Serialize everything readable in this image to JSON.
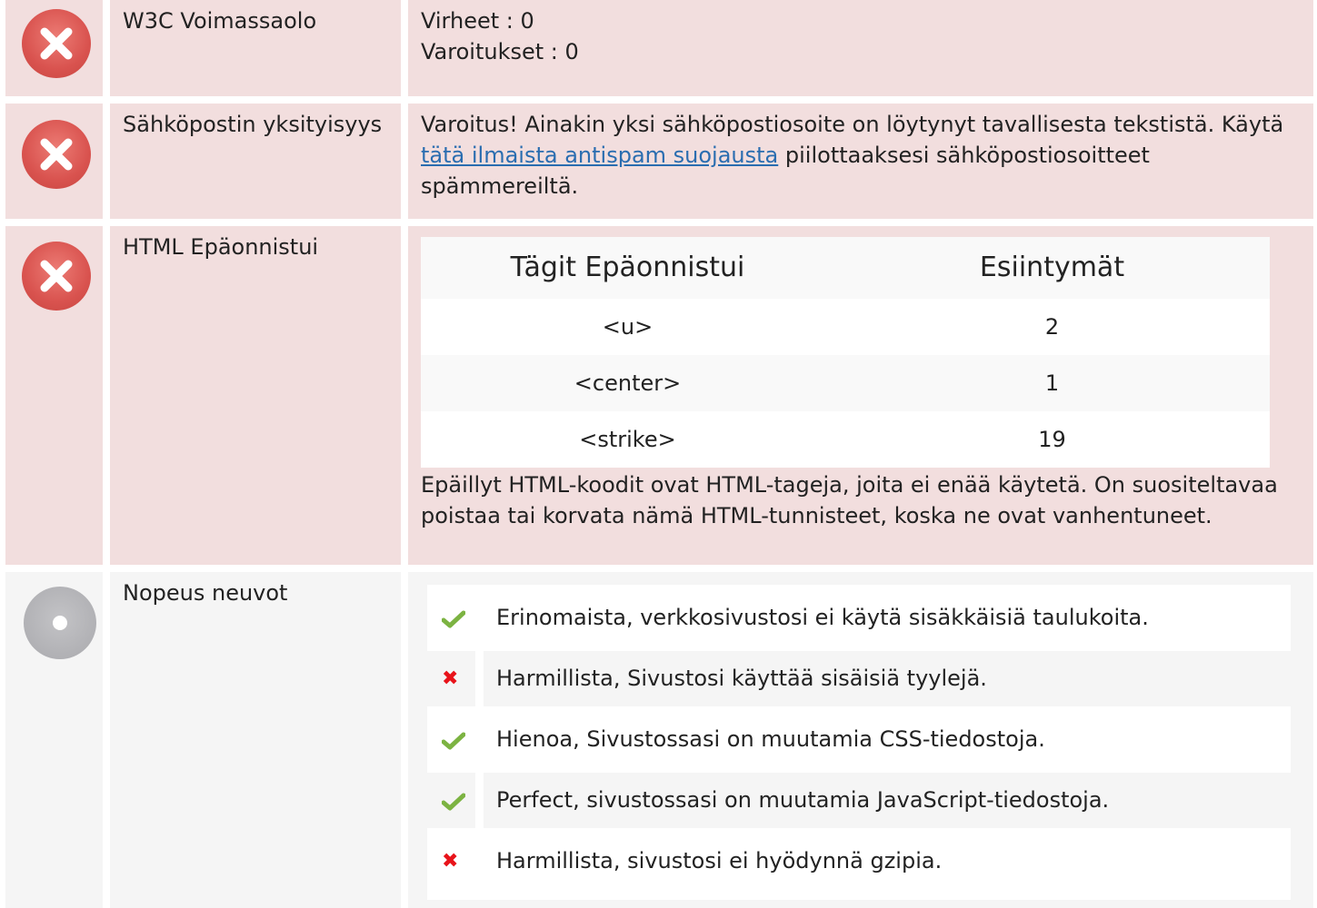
{
  "rows": [
    {
      "label": "W3C Voimassaolo",
      "status": "fail",
      "errors_text": "Virheet : 0",
      "warnings_text": "Varoitukset : 0"
    },
    {
      "label": "Sähköpostin yksityisyys",
      "status": "fail",
      "text_before": "Varoitus! Ainakin yksi sähköpostiosoite on löytynyt tavallisesta tekstistä. Käytä ",
      "link_text": "tätä ilmaista antispam suojausta",
      "text_after": " piilottaaksesi sähköpostiosoitteet spämmereiltä."
    },
    {
      "label": "HTML Epäonnistui",
      "status": "fail",
      "table": {
        "headers": [
          "Tägit Epäonnistui",
          "Esiintymät"
        ],
        "rows": [
          {
            "tag": "<u>",
            "count": "2"
          },
          {
            "tag": "<center>",
            "count": "1"
          },
          {
            "tag": "<strike>",
            "count": "19"
          }
        ]
      },
      "note": "Epäillyt HTML-koodit ovat HTML-tageja, joita ei enää käytetä. On suositeltavaa poistaa tai korvata nämä HTML-tunnisteet, koska ne ovat vanhentuneet."
    },
    {
      "label": "Nopeus neuvot",
      "status": "neutral",
      "tips": [
        {
          "status": "pass",
          "icon": "check-icon",
          "text": "Erinomaista, verkkosivustosi ei käytä sisäkkäisiä taulukoita."
        },
        {
          "status": "fail",
          "icon": "x-icon",
          "text": "Harmillista, Sivustosi käyttää sisäisiä tyylejä."
        },
        {
          "status": "pass",
          "icon": "check-icon",
          "text": "Hienoa, Sivustossasi on muutamia CSS-tiedostoja."
        },
        {
          "status": "pass",
          "icon": "check-icon",
          "text": "Perfect, sivustossasi on muutamia JavaScript-tiedostoja."
        },
        {
          "status": "fail",
          "icon": "x-icon",
          "text": "Harmillista, sivustosi ei hyödynnä gzipia."
        }
      ]
    }
  ],
  "icons": {
    "fail_mark": "✖",
    "neutral_circle_color": "#a9a9ad",
    "fail_circle_color": "#d9534f",
    "check_color": "#7cb342",
    "x_color": "#e8131a"
  }
}
